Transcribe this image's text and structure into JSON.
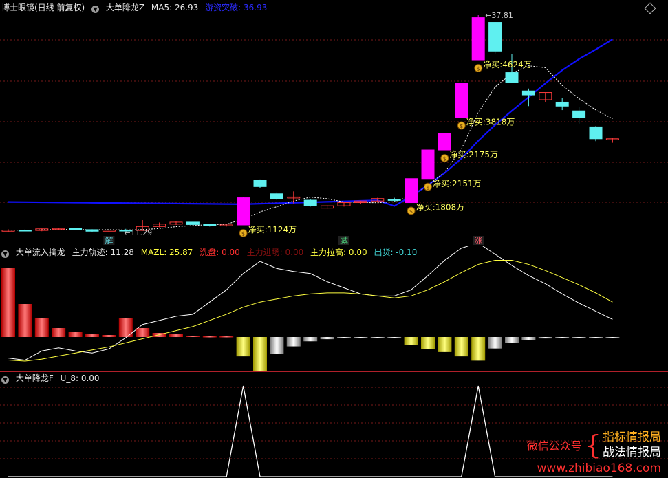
{
  "main": {
    "title": "博士眼镜(日线 前复权)",
    "indicator": "大单降龙Z",
    "ma5_label": "MA5: 26.93",
    "breakout_label": "游资突破: 36.93",
    "candles": [
      {
        "o": 10.7,
        "h": 10.95,
        "l": 10.55,
        "c": 10.85
      },
      {
        "o": 10.85,
        "h": 10.95,
        "l": 10.7,
        "c": 10.8
      },
      {
        "o": 10.8,
        "h": 11.05,
        "l": 10.7,
        "c": 11.0
      },
      {
        "o": 11.0,
        "h": 11.15,
        "l": 10.9,
        "c": 11.05
      },
      {
        "o": 11.05,
        "h": 11.1,
        "l": 10.85,
        "c": 10.9
      },
      {
        "o": 10.9,
        "h": 10.95,
        "l": 10.65,
        "c": 10.7
      },
      {
        "o": 10.7,
        "h": 10.9,
        "l": 10.55,
        "c": 10.85
      },
      {
        "o": 10.85,
        "h": 11.0,
        "l": 10.7,
        "c": 10.8
      },
      {
        "o": 10.8,
        "h": 12.1,
        "l": 10.75,
        "c": 11.3
      },
      {
        "o": 11.3,
        "h": 11.8,
        "l": 11.2,
        "c": 11.6
      },
      {
        "o": 11.6,
        "h": 11.95,
        "l": 11.5,
        "c": 11.85
      },
      {
        "o": 11.85,
        "h": 11.9,
        "l": 11.45,
        "c": 11.55
      },
      {
        "o": 11.55,
        "h": 11.6,
        "l": 11.3,
        "c": 11.4
      },
      {
        "o": 11.4,
        "h": 11.55,
        "l": 11.3,
        "c": 11.5
      },
      {
        "o": 11.5,
        "h": 15.0,
        "l": 11.5,
        "c": 14.9
      },
      {
        "o": 17.1,
        "h": 17.2,
        "l": 16.1,
        "c": 16.3
      },
      {
        "o": 15.4,
        "h": 15.6,
        "l": 14.6,
        "c": 14.8
      },
      {
        "o": 14.9,
        "h": 15.7,
        "l": 14.2,
        "c": 15.0
      },
      {
        "o": 14.6,
        "h": 14.7,
        "l": 13.8,
        "c": 13.9
      },
      {
        "o": 13.6,
        "h": 14.0,
        "l": 13.5,
        "c": 13.9
      },
      {
        "o": 13.9,
        "h": 14.4,
        "l": 13.8,
        "c": 14.3
      },
      {
        "o": 14.3,
        "h": 14.5,
        "l": 14.1,
        "c": 14.5
      },
      {
        "o": 14.5,
        "h": 14.9,
        "l": 14.3,
        "c": 14.8
      },
      {
        "o": 14.7,
        "h": 14.9,
        "l": 14.4,
        "c": 14.6
      },
      {
        "o": 14.3,
        "h": 17.3,
        "l": 14.3,
        "c": 17.3
      },
      {
        "o": 17.3,
        "h": 20.9,
        "l": 17.3,
        "c": 20.9
      },
      {
        "o": 20.9,
        "h": 23.0,
        "l": 20.9,
        "c": 23.0
      },
      {
        "o": 25.0,
        "h": 29.3,
        "l": 25.0,
        "c": 29.3
      },
      {
        "o": 32.2,
        "h": 37.81,
        "l": 32.2,
        "c": 37.5
      },
      {
        "o": 36.9,
        "h": 36.95,
        "l": 33.0,
        "c": 33.3
      },
      {
        "o": 30.6,
        "h": 32.9,
        "l": 29.3,
        "c": 29.4
      },
      {
        "o": 28.3,
        "h": 28.6,
        "l": 26.4,
        "c": 27.8
      },
      {
        "o": 27.2,
        "h": 28.1,
        "l": 26.9,
        "c": 28.1
      },
      {
        "o": 26.9,
        "h": 27.4,
        "l": 25.9,
        "c": 26.4
      },
      {
        "o": 25.8,
        "h": 26.3,
        "l": 24.2,
        "c": 25.0
      },
      {
        "o": 23.8,
        "h": 23.9,
        "l": 22.0,
        "c": 22.3
      },
      {
        "o": 22.2,
        "h": 22.4,
        "l": 21.8,
        "c": 22.3
      }
    ],
    "max_price_label": "37.81",
    "min_price_label": "11.29",
    "net_buy_labels": [
      {
        "idx": 14,
        "text": "净买:1124万"
      },
      {
        "idx": 24,
        "text": "净买:1808万"
      },
      {
        "idx": 25,
        "text": "净买:2151万"
      },
      {
        "idx": 26,
        "text": "净买:2175万"
      },
      {
        "idx": 27,
        "text": "净买:3818万"
      },
      {
        "idx": 28,
        "text": "净买:4624万"
      }
    ],
    "markers": [
      {
        "idx": 6,
        "text": "解",
        "color": "#5fd0d8"
      },
      {
        "idx": 20,
        "text": "减",
        "color": "#4ad07a"
      },
      {
        "idx": 28,
        "text": "涨",
        "color": "#ff5a6a"
      }
    ]
  },
  "flow": {
    "title": "大单流入擒龙",
    "main_track_label": "主力轨迹: 11.28",
    "mazl_label": "MAZL: 25.87",
    "wash_label": "洗盘: 0.00",
    "enter_label": "主力进场: 0.00",
    "pull_label": "主力拉高: 0.00",
    "out_label": "出货: -0.10",
    "bars": [
      {
        "v": 100,
        "c": "red"
      },
      {
        "v": 48,
        "c": "red"
      },
      {
        "v": 27,
        "c": "red"
      },
      {
        "v": 13,
        "c": "red"
      },
      {
        "v": 7,
        "c": "red"
      },
      {
        "v": 5,
        "c": "red"
      },
      {
        "v": 3,
        "c": "red"
      },
      {
        "v": 27,
        "c": "red"
      },
      {
        "v": 13,
        "c": "red"
      },
      {
        "v": 6,
        "c": "red"
      },
      {
        "v": 4,
        "c": "red"
      },
      {
        "v": 2,
        "c": "red"
      },
      {
        "v": 1,
        "c": "red"
      },
      {
        "v": 1,
        "c": "red"
      },
      {
        "v": -27,
        "c": "yellow"
      },
      {
        "v": -48,
        "c": "yellow"
      },
      {
        "v": -24,
        "c": "gray"
      },
      {
        "v": -13,
        "c": "gray"
      },
      {
        "v": -6,
        "c": "gray"
      },
      {
        "v": -3,
        "c": "gray"
      },
      {
        "v": -1,
        "c": "gray"
      },
      {
        "v": -1,
        "c": "gray"
      },
      {
        "v": -1,
        "c": "gray"
      },
      {
        "v": -1,
        "c": "gray"
      },
      {
        "v": -11,
        "c": "yellow"
      },
      {
        "v": -17,
        "c": "yellow"
      },
      {
        "v": -21,
        "c": "yellow"
      },
      {
        "v": -27,
        "c": "yellow"
      },
      {
        "v": -33,
        "c": "yellow"
      },
      {
        "v": -16,
        "c": "gray"
      },
      {
        "v": -8,
        "c": "gray"
      },
      {
        "v": -4,
        "c": "gray"
      },
      {
        "v": -2,
        "c": "gray"
      },
      {
        "v": -1,
        "c": "gray"
      },
      {
        "v": -1,
        "c": "gray"
      },
      {
        "v": -1,
        "c": "gray"
      },
      {
        "v": -1,
        "c": "gray"
      }
    ],
    "white_line": [
      5,
      3,
      12,
      15,
      12,
      10,
      14,
      25,
      38,
      42,
      46,
      48,
      60,
      72,
      88,
      100,
      93,
      90,
      88,
      80,
      74,
      68,
      66,
      66,
      72,
      86,
      101,
      113,
      118,
      107,
      96,
      86,
      78,
      68,
      59,
      51,
      43
    ],
    "yellow_line": [
      3,
      2,
      4,
      7,
      10,
      13,
      16,
      20,
      24,
      28,
      32,
      36,
      42,
      48,
      55,
      60,
      63,
      66,
      68,
      69,
      69,
      68,
      66,
      64,
      66,
      72,
      80,
      89,
      97,
      101,
      101,
      97,
      91,
      84,
      77,
      69,
      60
    ]
  },
  "flowf": {
    "title": "大单降龙F",
    "u8_label": "U_8: 0.00",
    "spikes": [
      0,
      0,
      0,
      0,
      0,
      0,
      0,
      0,
      0,
      0,
      0,
      0,
      0,
      0,
      1,
      0,
      0,
      0,
      0,
      0,
      0,
      0,
      0,
      0,
      0,
      0,
      0,
      0,
      1,
      0,
      0,
      0,
      0,
      0,
      0,
      0,
      0
    ]
  },
  "watermark": {
    "wechat": "微信公众号",
    "line1": "指标情报局",
    "line2": "战法情报局",
    "url": "www.zhibiao168.com"
  },
  "colors": {
    "up": "#ff3b3b",
    "down": "#5ff0f0",
    "magenta": "#ff00ff",
    "blue": "#1010ff",
    "yellow": "#ffff00",
    "grid": "#7a1a1a"
  }
}
